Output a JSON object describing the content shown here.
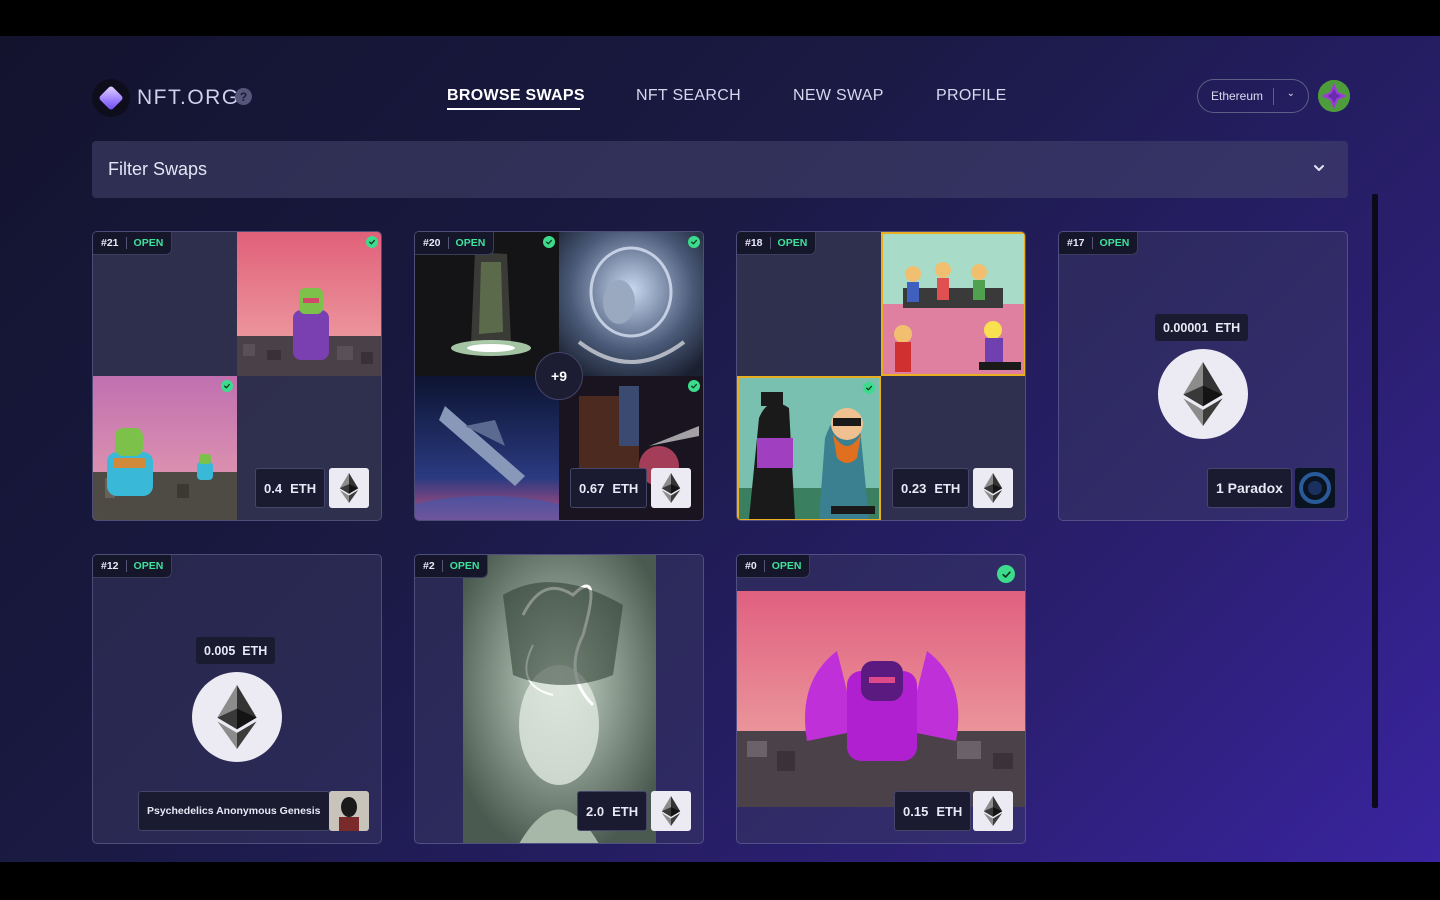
{
  "header": {
    "logo_text": "NFT.ORG",
    "help": "?",
    "nav": [
      {
        "label": "BROWSE SWAPS",
        "active": true
      },
      {
        "label": "NFT SEARCH",
        "active": false
      },
      {
        "label": "NEW SWAP",
        "active": false
      },
      {
        "label": "PROFILE",
        "active": false
      }
    ],
    "chain": "Ethereum"
  },
  "filter": {
    "label": "Filter Swaps"
  },
  "colors": {
    "accent_green": "#3ddc8c",
    "status_open": "#3ee39a",
    "card_bg": "#2e2e52"
  },
  "swaps": [
    {
      "id": "#21",
      "status": "OPEN",
      "price": "0.4",
      "unit": "ETH"
    },
    {
      "id": "#20",
      "status": "OPEN",
      "price": "0.67",
      "unit": "ETH",
      "more": "+9"
    },
    {
      "id": "#18",
      "status": "OPEN",
      "price": "0.23",
      "unit": "ETH"
    },
    {
      "id": "#17",
      "status": "OPEN",
      "eth_amount": "0.00001",
      "unit": "ETH",
      "collection": "1 Paradox"
    },
    {
      "id": "#12",
      "status": "OPEN",
      "eth_amount": "0.005",
      "unit": "ETH",
      "collection": "Psychedelics Anonymous Genesis"
    },
    {
      "id": "#2",
      "status": "OPEN",
      "price": "2.0",
      "unit": "ETH"
    },
    {
      "id": "#0",
      "status": "OPEN",
      "price": "0.15",
      "unit": "ETH"
    }
  ]
}
